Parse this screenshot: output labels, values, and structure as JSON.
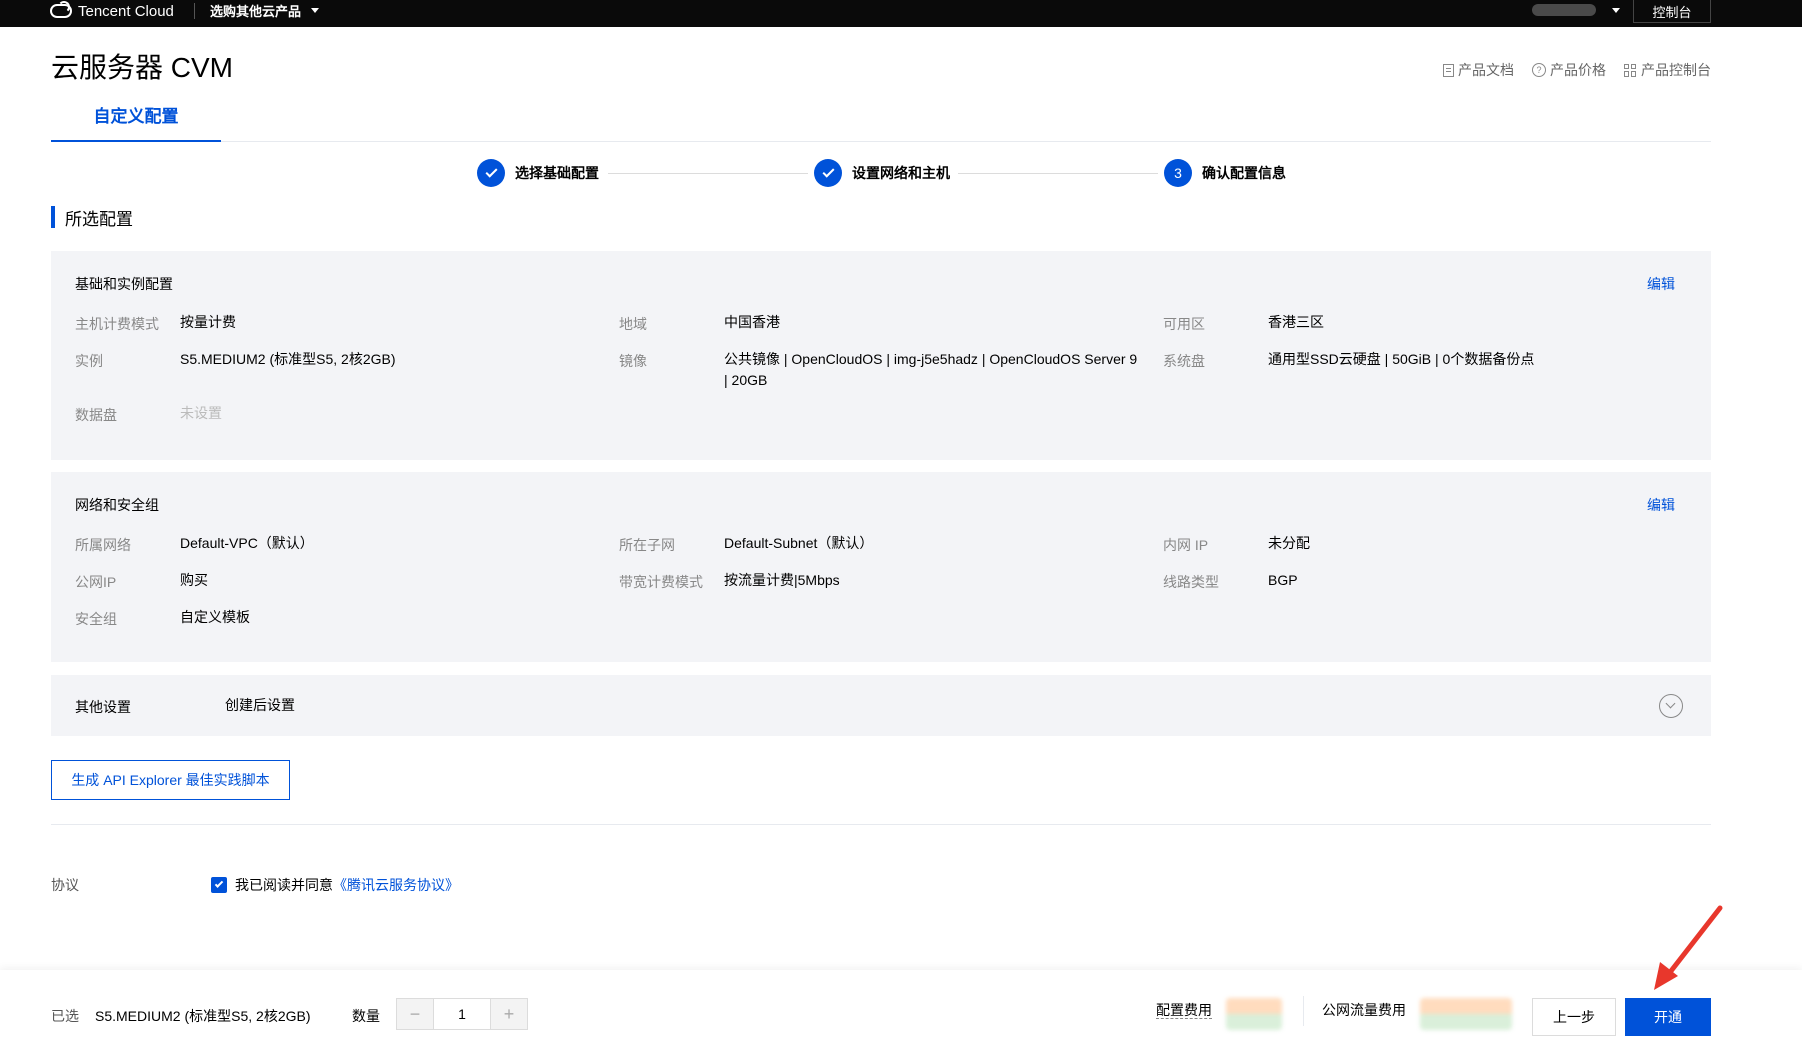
{
  "topbar": {
    "brand": "Tencent Cloud",
    "products_menu": "选购其他云产品",
    "console": "控制台"
  },
  "header": {
    "title": "云服务器 CVM",
    "links": [
      "产品文档",
      "产品价格",
      "产品控制台"
    ]
  },
  "tab": {
    "label": "自定义配置"
  },
  "steps": [
    {
      "label": "选择基础配置",
      "state": "done"
    },
    {
      "label": "设置网络和主机",
      "state": "done"
    },
    {
      "label": "确认配置信息",
      "state": "current",
      "number": "3"
    }
  ],
  "section": {
    "title": "所选配置"
  },
  "basic": {
    "title": "基础和实例配置",
    "edit": "编辑",
    "billing_label": "主机计费模式",
    "billing_value": "按量计费",
    "region_label": "地域",
    "region_value": "中国香港",
    "zone_label": "可用区",
    "zone_value": "香港三区",
    "instance_label": "实例",
    "instance_value": "S5.MEDIUM2 (标准型S5, 2核2GB)",
    "image_label": "镜像",
    "image_value_1": "公共镜像 | OpenCloudOS | img-j5e5hadz | OpenCloudOS Server 9",
    "image_value_2": "| 20GB",
    "sysdisk_label": "系统盘",
    "sysdisk_value": "通用型SSD云硬盘 | 50GiB | 0个数据备份点",
    "datadisk_label": "数据盘",
    "datadisk_value": "未设置"
  },
  "network": {
    "title": "网络和安全组",
    "edit": "编辑",
    "vpc_label": "所属网络",
    "vpc_value": "Default-VPC（默认）",
    "subnet_label": "所在子网",
    "subnet_value": "Default-Subnet（默认）",
    "privip_label": "内网 IP",
    "privip_value": "未分配",
    "pubip_label": "公网IP",
    "pubip_value": "购买",
    "bandwidth_label": "带宽计费模式",
    "bandwidth_value": "按流量计费|5Mbps",
    "line_label": "线路类型",
    "line_value": "BGP",
    "sg_label": "安全组",
    "sg_value": "自定义模板"
  },
  "other": {
    "title": "其他设置",
    "value": "创建后设置"
  },
  "api_button": "生成 API Explorer 最佳实践脚本",
  "agreement": {
    "label": "协议",
    "text": "我已阅读并同意",
    "link": "《腾讯云服务协议》",
    "checked": true
  },
  "bottom": {
    "selected_label": "已选",
    "selected_value": "S5.MEDIUM2 (标准型S5, 2核2GB)",
    "quantity_label": "数量",
    "quantity": "1",
    "config_fee_label": "配置费用",
    "traffic_fee_label": "公网流量费用",
    "prev": "上一步",
    "open": "开通"
  },
  "colors": {
    "accent": "#0052d9",
    "annotation": "#e8372c"
  }
}
